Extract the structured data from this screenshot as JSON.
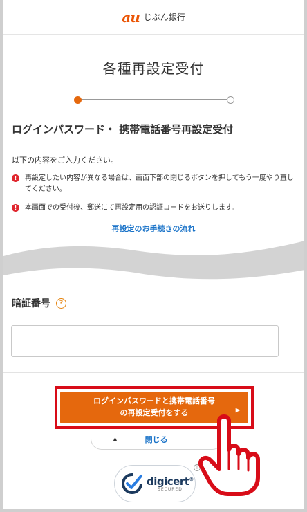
{
  "header": {
    "logo_au": "au",
    "logo_text": "じぶん銀行"
  },
  "page_title": "各種再設定受付",
  "section_title": "ログインパスワード・ 携帯電話番号再設定受付",
  "intro": "以下の内容をご入力ください。",
  "notes": [
    "再設定したい内容が異なる場合は、画面下部の閉じるボタンを押してもう一度やり直してください。",
    "本画面での受付後、郵送にて再設定用の認証コードをお送りします。"
  ],
  "note_icon_glyph": "!",
  "flow_link": "再設定のお手続きの流れ",
  "field": {
    "label": "暗証番号",
    "help_glyph": "?",
    "value": "",
    "placeholder": ""
  },
  "submit": {
    "line1": "ログインパスワードと携帯電話番号",
    "line2": "の再設定受付をする",
    "arrow": "▶"
  },
  "close": {
    "label": "閉じる",
    "arrow": "▲"
  },
  "seal": {
    "name": "digicert",
    "trademark": "®",
    "secured": "SECURED",
    "info": "i"
  },
  "colors": {
    "accent": "#e5680d",
    "highlight_border": "#d80c18",
    "link": "#1a73c8",
    "alert": "#e0262e"
  },
  "progress": {
    "current_step": 1,
    "total_steps": 2
  }
}
